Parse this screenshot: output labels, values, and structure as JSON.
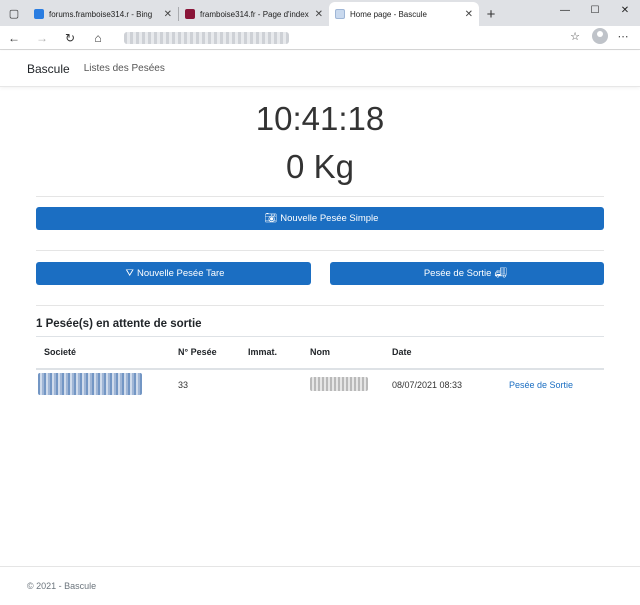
{
  "browser": {
    "tabs": [
      {
        "title": "forums.framboise314.r - Bing",
        "favicon_color": "#2a7de1"
      },
      {
        "title": "framboise314.fr - Page d'index",
        "favicon_color": "#8a1538"
      },
      {
        "title": "Home page - Bascule",
        "favicon_color": "#c9d9ee"
      }
    ],
    "active_tab": 2
  },
  "site": {
    "brand": "Bascule",
    "nav_link": "Listes des Pesées"
  },
  "clock": "10:41:18",
  "weight": "0 Kg",
  "buttons": {
    "simple": "Nouvelle Pesée Simple",
    "tare": "Nouvelle Pesée Tare",
    "sortie": "Pesée de Sortie"
  },
  "pending": {
    "title": "1 Pesée(s) en attente de sortie",
    "columns": [
      "Societé",
      "N° Pesée",
      "Immat.",
      "Nom",
      "Date",
      ""
    ],
    "rows": [
      {
        "numero": "33",
        "immat": "",
        "date": "08/07/2021 08:33",
        "action": "Pesée de Sortie"
      }
    ]
  },
  "footer": "© 2021 - Bascule",
  "colors": {
    "primary": "#1b6ec2",
    "tabbar": "#dfe1e5"
  }
}
